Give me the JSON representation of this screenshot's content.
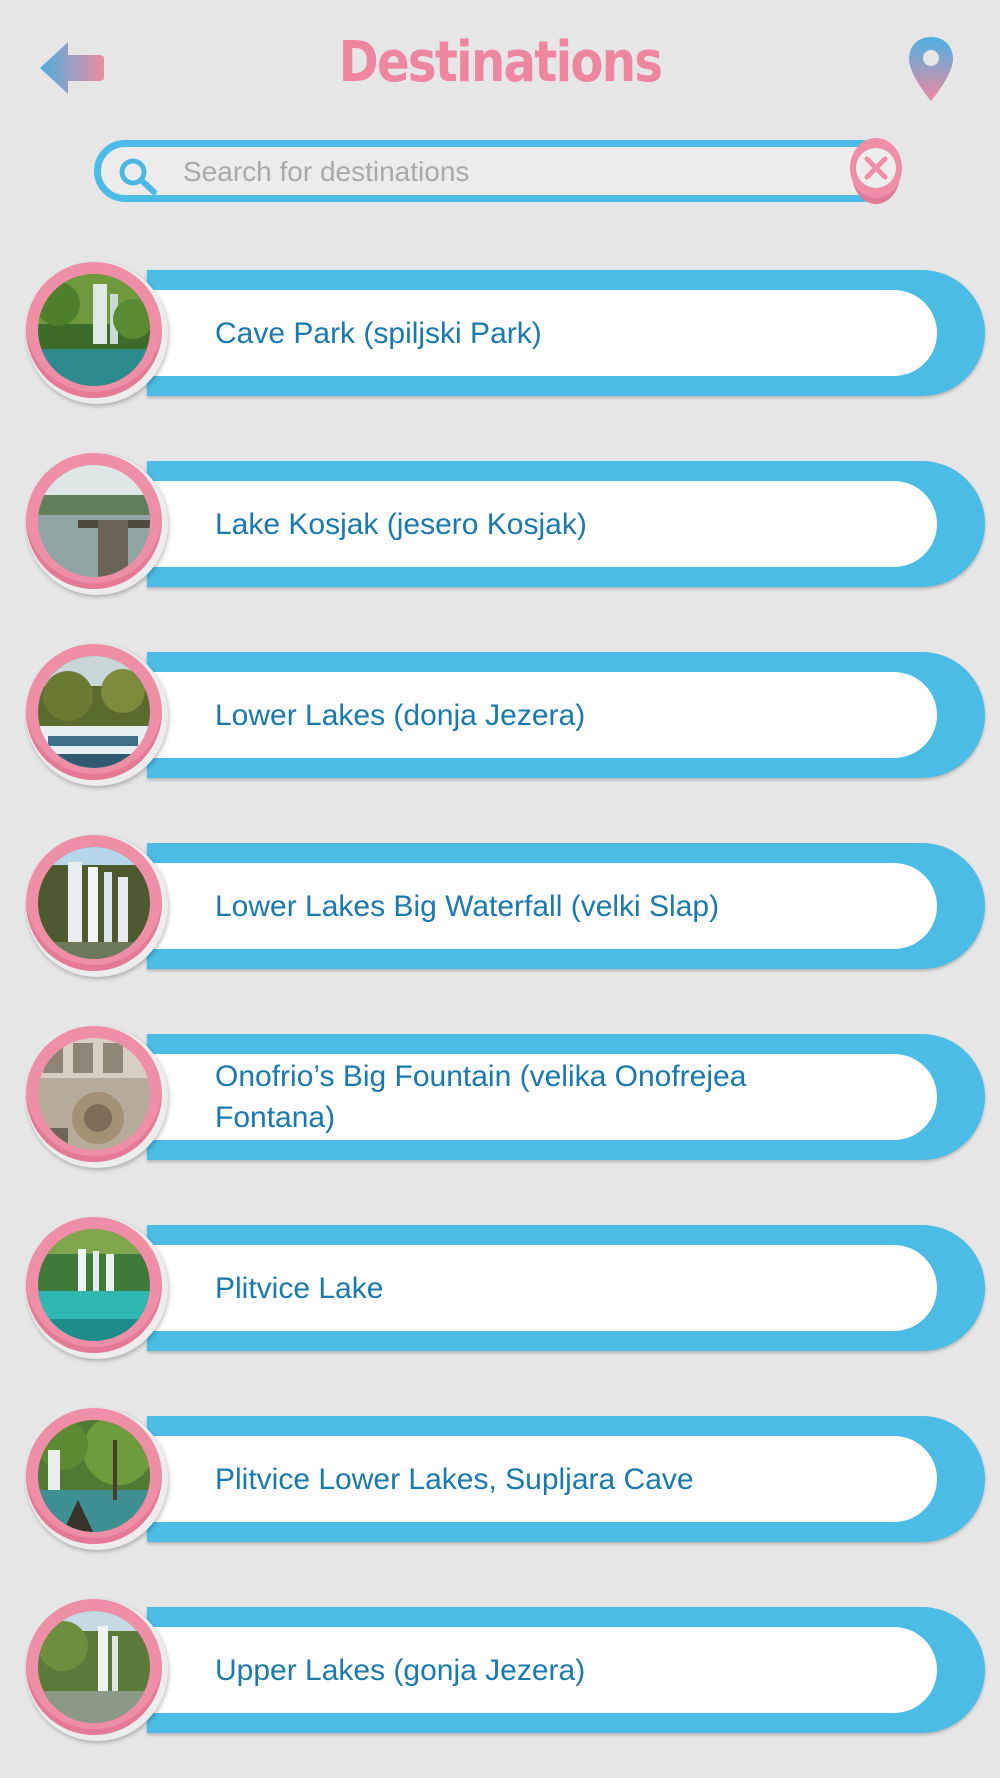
{
  "header": {
    "title": "Destinations"
  },
  "search": {
    "placeholder": "Search for destinations",
    "value": ""
  },
  "colors": {
    "background": "#e6e6e7",
    "accent_blue": "#4bbce6",
    "accent_pink": "#ee86a0",
    "label_text": "#1a79ad"
  },
  "icons": {
    "back": "back-arrow-icon",
    "location": "map-pin-icon",
    "search": "search-icon",
    "clear": "close-icon"
  },
  "destinations": [
    {
      "label": "Cave Park (spiljski Park)",
      "thumbnail": "waterfall-forest"
    },
    {
      "label": "Lake Kosjak (jesero Kosjak)",
      "thumbnail": "lake-dock"
    },
    {
      "label": "Lower Lakes (donja Jezera)",
      "thumbnail": "cascades"
    },
    {
      "label": "Lower Lakes Big Waterfall (velki Slap)",
      "thumbnail": "big-waterfall"
    },
    {
      "label": "Onofrio’s Big Fountain (velika Onofrejea Fontana)",
      "thumbnail": "fountain"
    },
    {
      "label": "Plitvice Lake",
      "thumbnail": "turquoise-lake"
    },
    {
      "label": "Plitvice Lower Lakes, Supljara Cave",
      "thumbnail": "trees-lake"
    },
    {
      "label": "Upper Lakes (gonja Jezera)",
      "thumbnail": "upper-waterfall"
    }
  ]
}
